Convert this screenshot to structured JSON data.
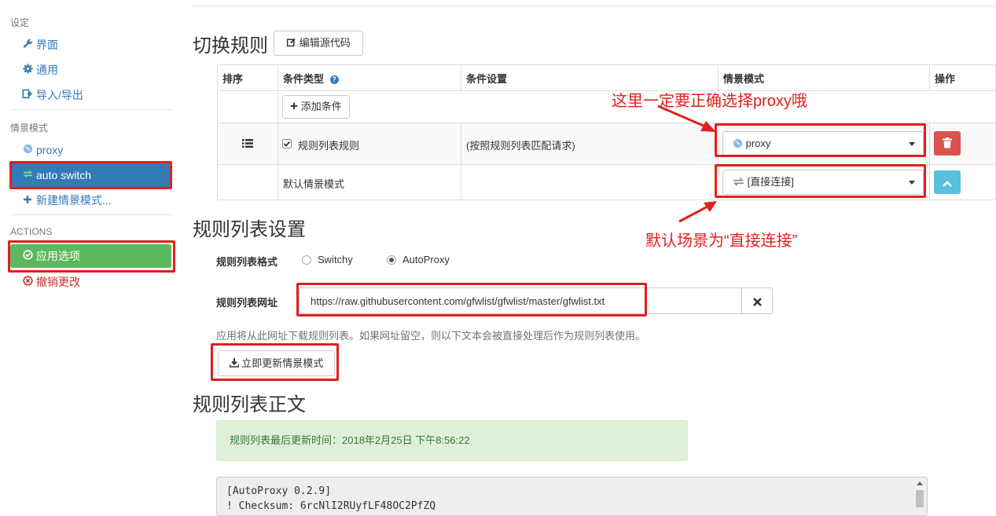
{
  "sidebar": {
    "settings_header": "设定",
    "settings_items": [
      {
        "label": "界面",
        "icon": "wrench-icon"
      },
      {
        "label": "通用",
        "icon": "gear-icon"
      },
      {
        "label": "导入/导出",
        "icon": "import-export-icon"
      }
    ],
    "profiles_header": "情景模式",
    "profiles": [
      {
        "label": "proxy",
        "icon": "globe-icon"
      },
      {
        "label": "auto switch",
        "icon": "switch-icon",
        "active": true
      }
    ],
    "new_profile": "新建情景模式...",
    "actions_header": "ACTIONS",
    "apply": "应用选项",
    "discard": "撤销更改"
  },
  "switch_rules": {
    "title": "切换规则",
    "edit_source": "编辑源代码",
    "headers": [
      "排序",
      "条件类型",
      "条件设置",
      "情景模式",
      "操作"
    ],
    "add_condition": "添加条件",
    "rule": {
      "type": "规则列表规则",
      "condition": "(按照规则列表匹配请求)",
      "profile": "proxy",
      "checked": true
    },
    "default": {
      "label": "默认情景模式",
      "profile": "[直接连接]"
    }
  },
  "annotations": {
    "top": "这里一定要正确选择proxy哦",
    "bottom": "默认场景为“直接连接”"
  },
  "rule_list_settings": {
    "title": "规则列表设置",
    "format_label": "规则列表格式",
    "format_options": [
      "Switchy",
      "AutoProxy"
    ],
    "format_selected": "AutoProxy",
    "url_label": "规则列表网址",
    "url_value": "https://raw.githubusercontent.com/gfwlist/gfwlist/master/gfwlist.txt",
    "help": "应用将从此网址下载规则列表。如果网址留空，则以下文本会被直接处理后作为规则列表使用。",
    "update_button": "立即更新情景模式"
  },
  "rule_list_text": {
    "title": "规则列表正文",
    "last_updated": "规则列表最后更新时间：2018年2月25日 下午8:56:22",
    "lines": [
      "[AutoProxy 0.2.9]",
      "! Checksum: 6rcNlI2RUyfLF48OC2PfZQ"
    ]
  },
  "colors": {
    "primary": "#337ab7",
    "success": "#5cb85c",
    "danger": "#d9534f",
    "info": "#5bc0de",
    "annotation": "#e0201b"
  }
}
